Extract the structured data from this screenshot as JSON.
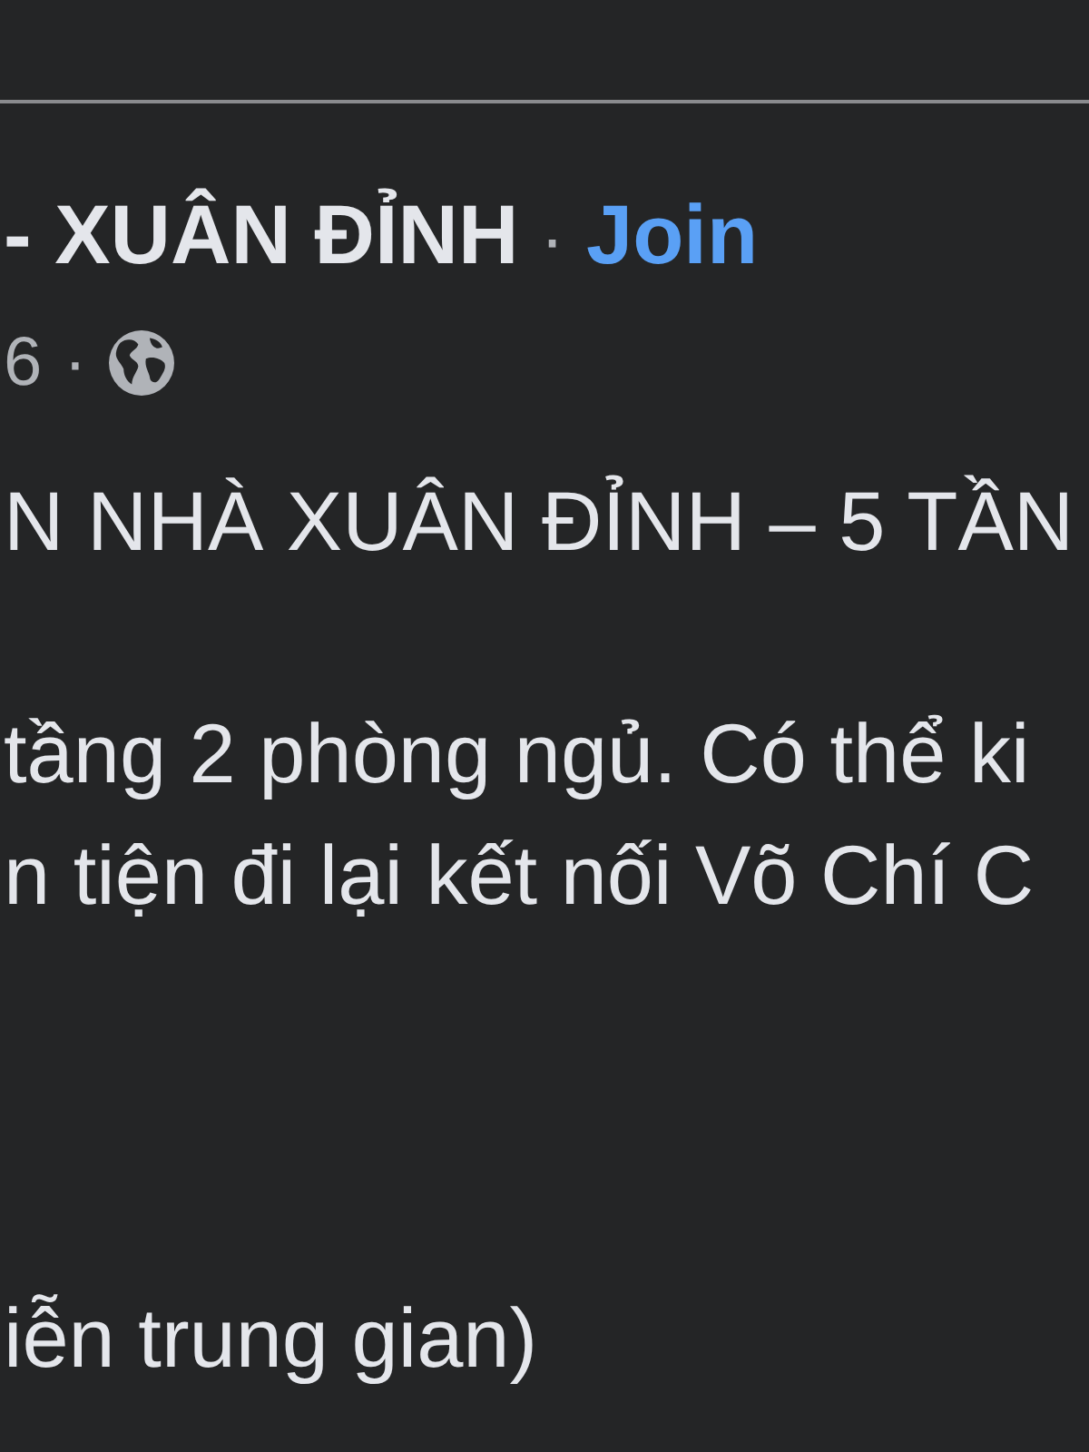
{
  "header": {
    "group_name": "- XUÂN ĐỈNH",
    "separator": "·",
    "join_link": "Join"
  },
  "meta": {
    "timestamp": "6",
    "separator": "·"
  },
  "body": [
    {
      "lines": [
        "N NHÀ XUÂN ĐỈNH – 5 TẦN"
      ]
    },
    {
      "lines": [
        "tầng 2 phòng ngủ. Có thể ki",
        "n tiện đi lại kết nối Võ Chí C"
      ]
    },
    {
      "lines": [
        "iễn trung gian)"
      ]
    }
  ]
}
